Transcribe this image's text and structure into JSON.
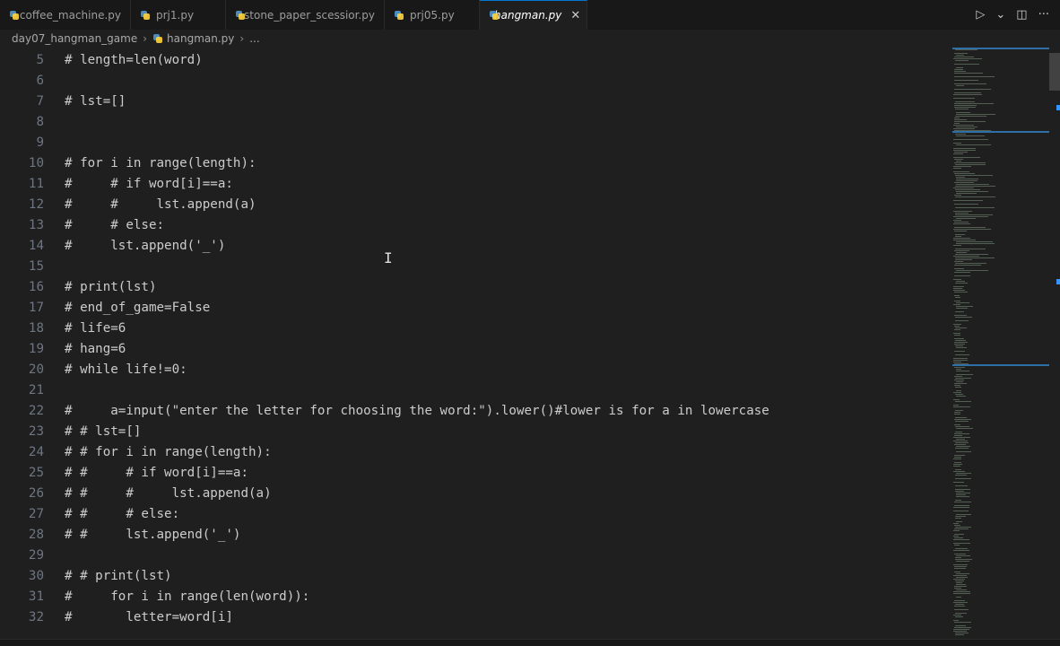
{
  "tabs": [
    {
      "label": "coffee_machine.py",
      "active": false
    },
    {
      "label": "prj1.py",
      "active": false
    },
    {
      "label": "stone_paper_scessior.py",
      "active": false
    },
    {
      "label": "prj05.py",
      "active": false
    },
    {
      "label": "hangman.py",
      "active": true
    }
  ],
  "tab_close_glyph": "✕",
  "actions": {
    "run_glyph": "▷",
    "run_menu_glyph": "⌄",
    "split_glyph": "◫",
    "more_glyph": "···"
  },
  "breadcrumb": {
    "folder": "day07_hangman_game",
    "file": "hangman.py",
    "rest": "...",
    "separator": "›"
  },
  "editor": {
    "lines": [
      {
        "num": "5",
        "text": "# length=len(word)"
      },
      {
        "num": "6",
        "text": ""
      },
      {
        "num": "7",
        "text": "# lst=[]"
      },
      {
        "num": "8",
        "text": ""
      },
      {
        "num": "9",
        "text": ""
      },
      {
        "num": "10",
        "text": "# for i in range(length):"
      },
      {
        "num": "11",
        "text": "#     # if word[i]==a:"
      },
      {
        "num": "12",
        "text": "#     #     lst.append(a)"
      },
      {
        "num": "13",
        "text": "#     # else:"
      },
      {
        "num": "14",
        "text": "#     lst.append('_')"
      },
      {
        "num": "15",
        "text": ""
      },
      {
        "num": "16",
        "text": "# print(lst)"
      },
      {
        "num": "17",
        "text": "# end_of_game=False"
      },
      {
        "num": "18",
        "text": "# life=6"
      },
      {
        "num": "19",
        "text": "# hang=6"
      },
      {
        "num": "20",
        "text": "# while life!=0:"
      },
      {
        "num": "21",
        "text": ""
      },
      {
        "num": "22",
        "text": "#     a=input(\"enter the letter for choosing the word:\").lower()#lower is for a in lowercase"
      },
      {
        "num": "23",
        "text": "# # lst=[]"
      },
      {
        "num": "24",
        "text": "# # for i in range(length):"
      },
      {
        "num": "25",
        "text": "# #     # if word[i]==a:"
      },
      {
        "num": "26",
        "text": "# #     #     lst.append(a)"
      },
      {
        "num": "27",
        "text": "# #     # else:"
      },
      {
        "num": "28",
        "text": "# #     lst.append('_')"
      },
      {
        "num": "29",
        "text": ""
      },
      {
        "num": "30",
        "text": "# # print(lst)"
      },
      {
        "num": "31",
        "text": "#     for i in range(len(word)):"
      },
      {
        "num": "32",
        "text": "#       letter=word[i]"
      }
    ],
    "comment_color": "#cccccc",
    "line_number_color": "#6e7681"
  }
}
